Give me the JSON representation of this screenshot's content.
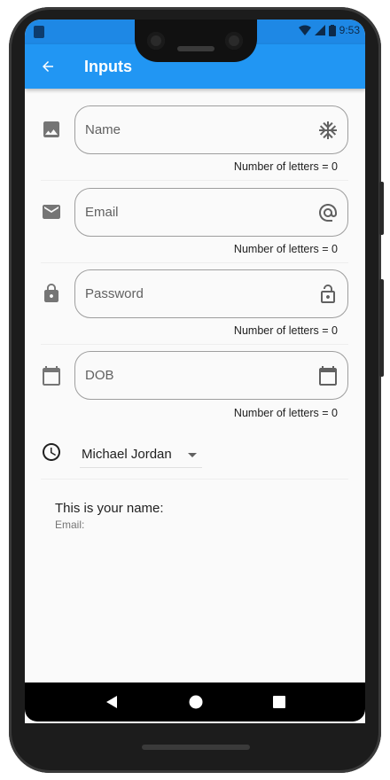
{
  "status_bar": {
    "time": "9:53"
  },
  "app_bar": {
    "title": "Inputs"
  },
  "fields": [
    {
      "label": "Name",
      "counter": "Number of letters = 0",
      "icon": "image-icon",
      "suffix_icon": "snowflake-icon"
    },
    {
      "label": "Email",
      "counter": "Number of letters = 0",
      "icon": "mail-icon",
      "suffix_icon": "at-icon"
    },
    {
      "label": "Password",
      "counter": "Number of letters = 0",
      "icon": "lock-icon",
      "suffix_icon": "lock-open-icon"
    },
    {
      "label": "DOB",
      "counter": "Number of letters = 0",
      "icon": "calendar-icon",
      "suffix_icon": "calendar-icon"
    }
  ],
  "dropdown": {
    "selected": "Michael Jordan",
    "icon": "clock-icon"
  },
  "output": {
    "name_line": "This is your name:",
    "email_line": "Email:"
  },
  "colors": {
    "app_bar": "#2196f3",
    "status_bar": "#1e88e5",
    "background": "#fafafa"
  }
}
